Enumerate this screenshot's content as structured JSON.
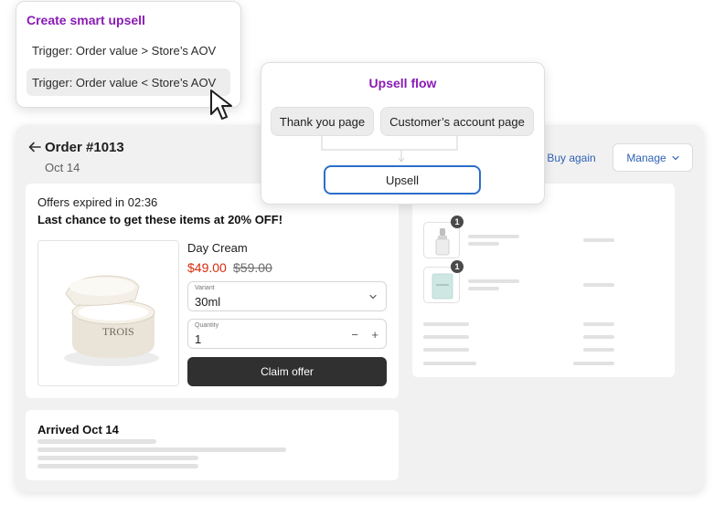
{
  "order": {
    "title": "Order #1013",
    "date": "Oct 14",
    "buy_again_label": "Buy again",
    "manage_label": "Manage"
  },
  "offer": {
    "timer_text": "Offers expired in 02:36",
    "headline": "Last chance to get these items at 20% OFF!",
    "product_name": "Day Cream",
    "product_image_text": "TROIS",
    "price_new": "$49.00",
    "price_old": "$59.00",
    "variant_label": "Variant",
    "variant_value": "30ml",
    "quantity_label": "Quantity",
    "quantity_value": "1",
    "minus_glyph": "−",
    "plus_glyph": "+",
    "claim_label": "Claim offer"
  },
  "arrived": {
    "title": "Arrived Oct 14"
  },
  "summary": {
    "items": [
      {
        "badge": "1",
        "icon": "serum-bottle-icon"
      },
      {
        "badge": "1",
        "icon": "sheet-mask-icon"
      }
    ]
  },
  "smart_upsell": {
    "title": "Create smart upsell",
    "triggers": [
      "Trigger: Order value > Store’s AOV",
      "Trigger: Order value < Store’s AOV"
    ]
  },
  "upsell_flow": {
    "title": "Upsell flow",
    "sources": [
      "Thank you page",
      "Customer’s account page"
    ],
    "target": "Upsell"
  },
  "colors": {
    "accent_purple": "#8a1bb5",
    "link_blue": "#2f63b5",
    "sale_red": "#d72c0d",
    "primary_dark": "#303030",
    "focus_blue": "#2c6ecb"
  }
}
